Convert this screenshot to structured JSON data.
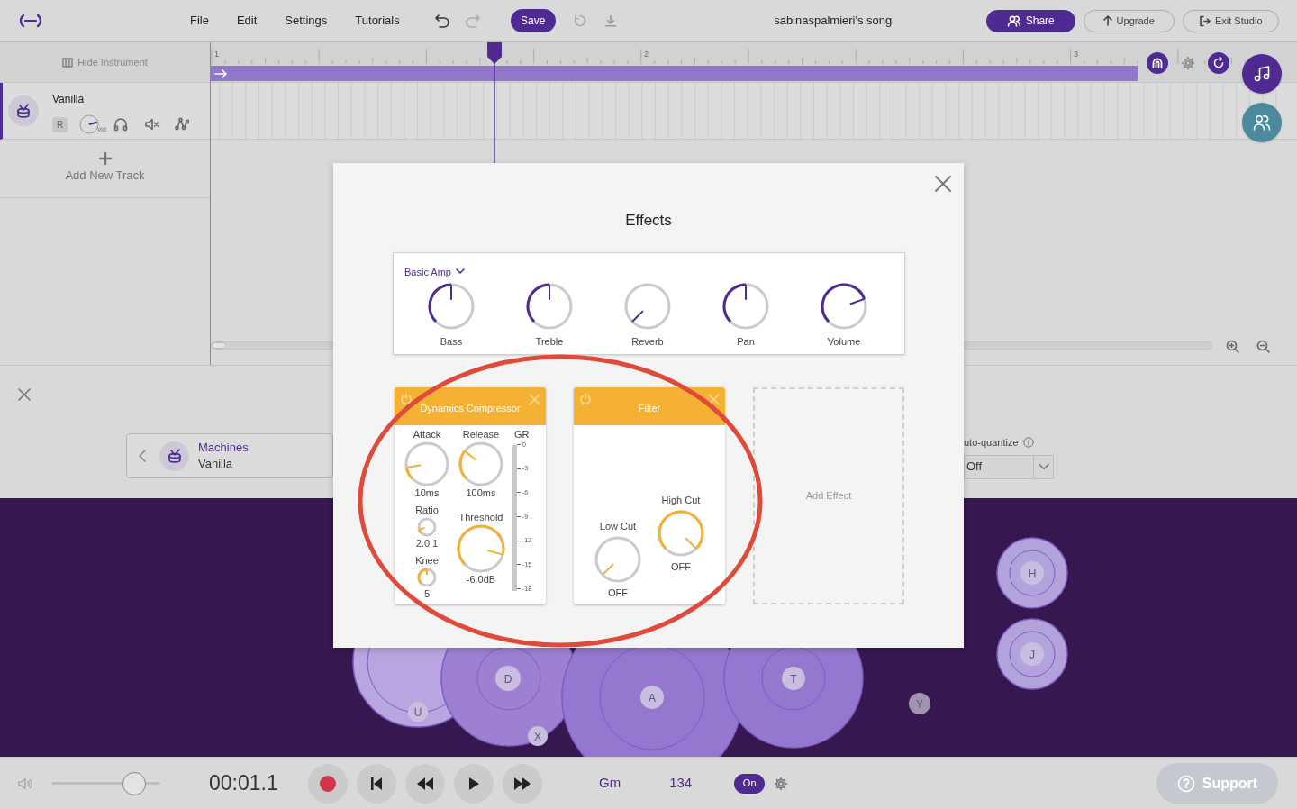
{
  "top_bar": {
    "menu": [
      "File",
      "Edit",
      "Settings",
      "Tutorials"
    ],
    "save": "Save",
    "song_title": "sabinaspalmieri's song",
    "share": "Share",
    "upgrade": "Upgrade",
    "exit": "Exit Studio"
  },
  "track_panel": {
    "hide_instrument": "Hide Instrument",
    "tracks": [
      {
        "name": "Vanilla",
        "selected": true,
        "record": "R",
        "volume": {
          "label": "Vol"
        }
      }
    ],
    "add_track": "Add New Track"
  },
  "timeline": {
    "bar_numbers": [
      "1",
      "2",
      "3"
    ]
  },
  "instrument_panel": {
    "category": "Machines",
    "instrument": "Vanilla",
    "auto_quantize_label": "uto-quantize",
    "auto_quantize_value": "Off"
  },
  "drum_pads": [
    {
      "key": "U"
    },
    {
      "key": "D"
    },
    {
      "key": "X"
    },
    {
      "key": "A"
    },
    {
      "key": "T"
    },
    {
      "key": "Y"
    },
    {
      "key": "H"
    },
    {
      "key": "J"
    }
  ],
  "transport": {
    "volume": {
      "level": 0.77
    },
    "time": "00:01.1",
    "key": "Gm",
    "tempo": "134",
    "metronome": {
      "label": "On",
      "on": true
    },
    "support": "Support"
  },
  "effects_dialog": {
    "title": "Effects",
    "amp": {
      "name": "Basic Amp",
      "knobs": [
        {
          "label": "Bass"
        },
        {
          "label": "Treble"
        },
        {
          "label": "Reverb"
        },
        {
          "label": "Pan"
        },
        {
          "label": "Volume"
        }
      ]
    },
    "effects": [
      {
        "kind": "compressor",
        "title": "Dynamics Compressor",
        "controls": [
          {
            "label": "Attack",
            "reading": "10ms"
          },
          {
            "label": "Release",
            "reading": "100ms"
          },
          {
            "label": "Ratio",
            "reading": "2.0:1"
          },
          {
            "label": "Threshold",
            "reading": "-6.0dB"
          },
          {
            "label": "Knee",
            "reading": "5"
          }
        ],
        "meter": {
          "label": "GR",
          "ticks": [
            "0",
            "-3",
            "-6",
            "-9",
            "-12",
            "-15",
            "-18"
          ]
        }
      },
      {
        "kind": "filter",
        "title": "Filter",
        "controls": [
          {
            "label": "Low Cut",
            "reading": "OFF"
          },
          {
            "label": "High Cut",
            "reading": "OFF"
          }
        ]
      }
    ],
    "add_effect": "Add Effect"
  }
}
